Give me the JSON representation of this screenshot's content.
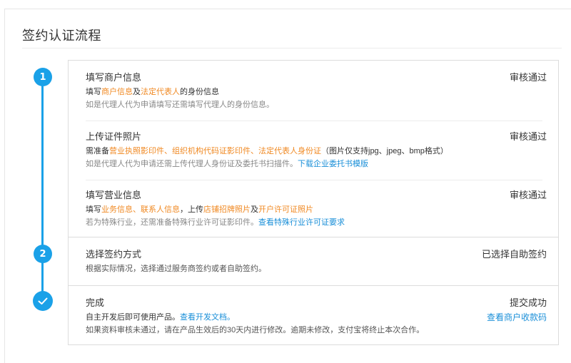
{
  "page": {
    "title": "签约认证流程"
  },
  "steps": [
    {
      "number": "1"
    },
    {
      "number": "2"
    },
    {
      "icon": "check-icon"
    }
  ],
  "step1": {
    "merchant_info": {
      "title": "填写商户信息",
      "status": "审核通过",
      "line1": [
        "填写",
        "商户信息",
        "及",
        "法定代表人",
        "的身份信息"
      ],
      "line2": "如是代理人代为申请填写还需填写代理人的身份信息。"
    },
    "documents": {
      "title": "上传证件照片",
      "status": "审核通过",
      "line1": [
        "需准备",
        "营业执照影印件",
        "、",
        "组织机构代码证影印件",
        "、",
        "法定代表人身份证",
        "（图片仅支持jpg、jpeg、bmp格式）"
      ],
      "line2_text": "如是代理人代为申请还需上传代理人身份证及委托书扫描件。",
      "line2_link": "下载企业委托书模版"
    },
    "business_info": {
      "title": "填写营业信息",
      "status": "审核通过",
      "line1": [
        "填写",
        "业务信息",
        "、",
        "联系人信息",
        "，上传",
        "店铺招牌照片",
        "及",
        "开户许可证照片"
      ],
      "line2_text": "若为特殊行业，还需准备特殊行业许可证影印件。",
      "line2_link": "查看特殊行业许可证要求"
    }
  },
  "step2": {
    "title": "选择签约方式",
    "status": "已选择自助签约",
    "line1": "根据实际情况，选择通过服务商签约或者自助签约。"
  },
  "step3": {
    "title": "完成",
    "status": "提交成功",
    "status_link": "查看商户收款码",
    "line1_text": "自主开发后即可使用产品。",
    "line1_link": "查看开发文档。",
    "line2": "如果资料审核未通过，请在产品生效后的30天内进行修改。逾期未修改，支付宝将终止本次合作。"
  },
  "colors": {
    "accent": "#1aa1e8",
    "highlight": "#f08a24",
    "link": "#1a8fd8"
  }
}
